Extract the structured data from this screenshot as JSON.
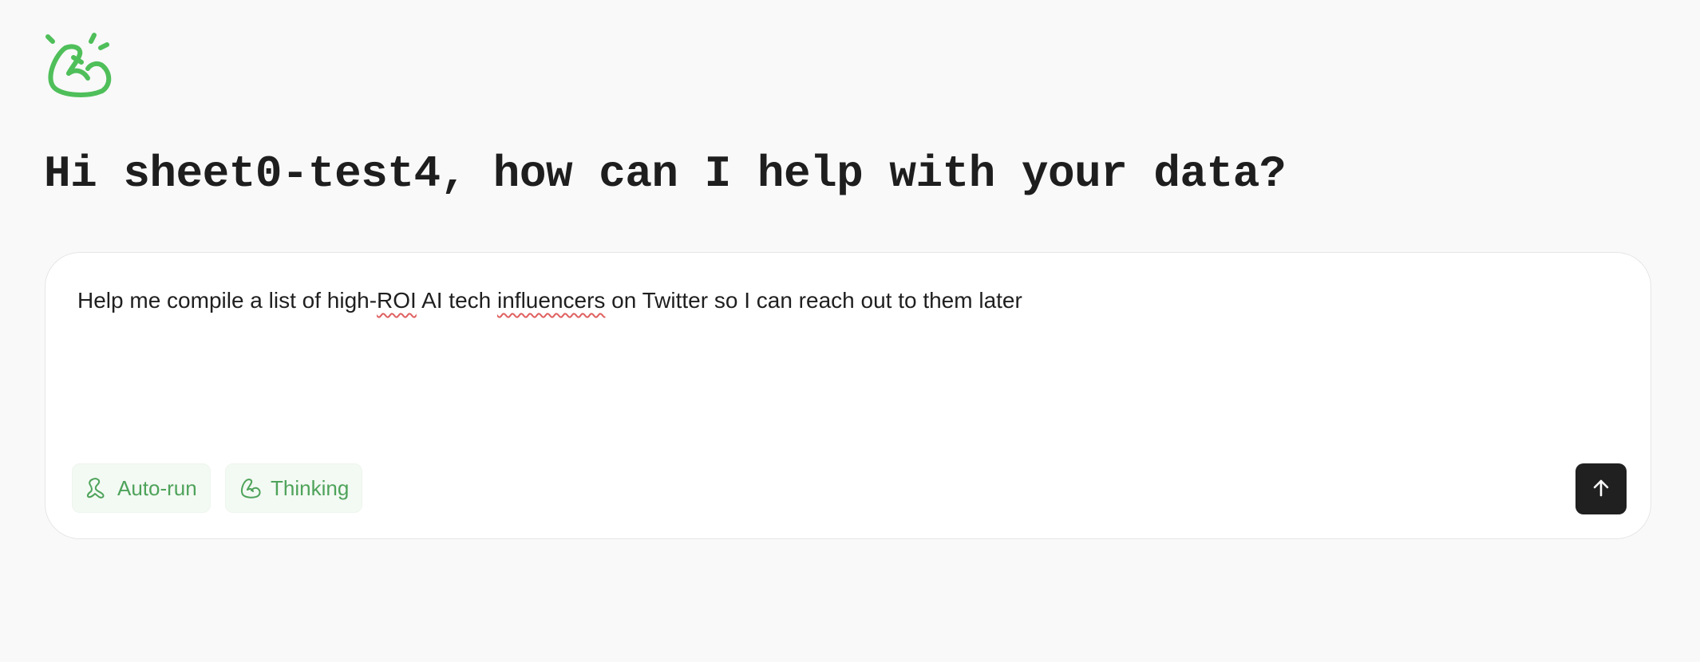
{
  "greeting": {
    "title": "Hi sheet0-test4, how can I help with your data?"
  },
  "composer": {
    "prompt_parts": {
      "a": "Help me compile a list of high-",
      "b": "ROI",
      "c": " AI tech ",
      "d": "influencers",
      "e": " on Twitter so I can reach out to them later"
    },
    "auto_run_label": "Auto-run",
    "thinking_label": "Thinking"
  },
  "icons": {
    "logo": "arm-logo-icon",
    "auto_run": "arm-icon",
    "thinking": "flexed-bicep-icon",
    "send": "arrow-up-icon"
  },
  "colors": {
    "brand_green": "#4fbf5a",
    "chip_text": "#4ea35a",
    "send_button": "#202020"
  }
}
